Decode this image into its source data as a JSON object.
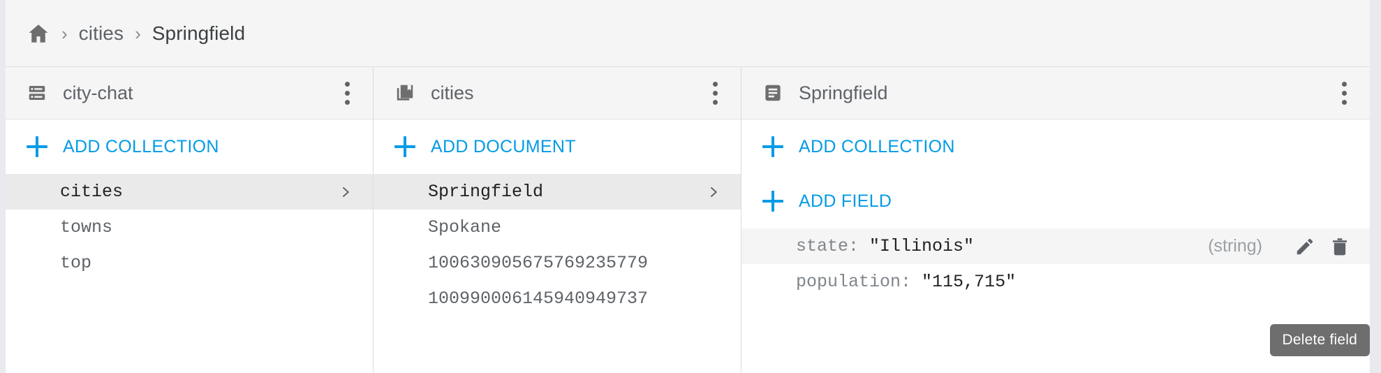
{
  "breadcrumb": {
    "home_icon": "home-icon",
    "separator": "›",
    "items": [
      {
        "label": "cities"
      },
      {
        "label": "Springfield"
      }
    ]
  },
  "panels": {
    "root": {
      "icon": "database-icon",
      "title": "city-chat",
      "menu_icon": "kebab-menu-icon",
      "add_label": "ADD COLLECTION",
      "add_icon": "plus-icon",
      "items": [
        {
          "label": "cities",
          "selected": true,
          "chevron": true
        },
        {
          "label": "towns",
          "selected": false,
          "chevron": false
        },
        {
          "label": "top",
          "selected": false,
          "chevron": false
        }
      ]
    },
    "documents": {
      "icon": "collection-icon",
      "title": "cities",
      "menu_icon": "kebab-menu-icon",
      "add_label": "ADD DOCUMENT",
      "add_icon": "plus-icon",
      "items": [
        {
          "label": "Springfield",
          "selected": true,
          "chevron": true
        },
        {
          "label": "Spokane",
          "selected": false,
          "chevron": false
        },
        {
          "label": "100630905675769235779",
          "selected": false,
          "chevron": false
        },
        {
          "label": "100990006145940949737",
          "selected": false,
          "chevron": false
        }
      ]
    },
    "fields": {
      "icon": "document-icon",
      "title": "Springfield",
      "menu_icon": "kebab-menu-icon",
      "add_collection_label": "ADD COLLECTION",
      "add_field_label": "ADD FIELD",
      "add_icon": "plus-icon",
      "edit_icon": "pencil-icon",
      "delete_icon": "trash-icon",
      "rows": [
        {
          "key": "state:",
          "value": "\"Illinois\"",
          "type": "(string)",
          "highlight": true,
          "show_actions": true
        },
        {
          "key": "population:",
          "value": "\"115,715\"",
          "type": "",
          "highlight": false,
          "show_actions": false
        }
      ]
    }
  },
  "tooltip": {
    "text": "Delete field"
  },
  "colors": {
    "accent": "#039be5",
    "header_bg": "#f5f5f5",
    "selected_row": "#eaeaea",
    "text_primary": "#202124",
    "text_secondary": "#5f6368",
    "text_muted": "#9aa0a6",
    "tooltip_bg": "#6e6e6e",
    "page_bg": "#e8eaed"
  }
}
